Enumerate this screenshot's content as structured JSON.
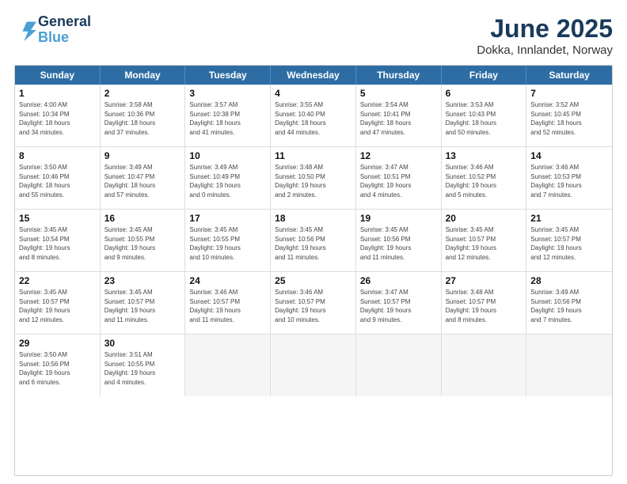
{
  "header": {
    "logo_line1": "General",
    "logo_line2": "Blue",
    "title": "June 2025",
    "subtitle": "Dokka, Innlandet, Norway"
  },
  "days_of_week": [
    "Sunday",
    "Monday",
    "Tuesday",
    "Wednesday",
    "Thursday",
    "Friday",
    "Saturday"
  ],
  "weeks": [
    [
      {
        "day": "1",
        "info": "Sunrise: 4:00 AM\nSunset: 10:34 PM\nDaylight: 18 hours\nand 34 minutes."
      },
      {
        "day": "2",
        "info": "Sunrise: 3:58 AM\nSunset: 10:36 PM\nDaylight: 18 hours\nand 37 minutes."
      },
      {
        "day": "3",
        "info": "Sunrise: 3:57 AM\nSunset: 10:38 PM\nDaylight: 18 hours\nand 41 minutes."
      },
      {
        "day": "4",
        "info": "Sunrise: 3:55 AM\nSunset: 10:40 PM\nDaylight: 18 hours\nand 44 minutes."
      },
      {
        "day": "5",
        "info": "Sunrise: 3:54 AM\nSunset: 10:41 PM\nDaylight: 18 hours\nand 47 minutes."
      },
      {
        "day": "6",
        "info": "Sunrise: 3:53 AM\nSunset: 10:43 PM\nDaylight: 18 hours\nand 50 minutes."
      },
      {
        "day": "7",
        "info": "Sunrise: 3:52 AM\nSunset: 10:45 PM\nDaylight: 18 hours\nand 52 minutes."
      }
    ],
    [
      {
        "day": "8",
        "info": "Sunrise: 3:50 AM\nSunset: 10:46 PM\nDaylight: 18 hours\nand 55 minutes."
      },
      {
        "day": "9",
        "info": "Sunrise: 3:49 AM\nSunset: 10:47 PM\nDaylight: 18 hours\nand 57 minutes."
      },
      {
        "day": "10",
        "info": "Sunrise: 3:49 AM\nSunset: 10:49 PM\nDaylight: 19 hours\nand 0 minutes."
      },
      {
        "day": "11",
        "info": "Sunrise: 3:48 AM\nSunset: 10:50 PM\nDaylight: 19 hours\nand 2 minutes."
      },
      {
        "day": "12",
        "info": "Sunrise: 3:47 AM\nSunset: 10:51 PM\nDaylight: 19 hours\nand 4 minutes."
      },
      {
        "day": "13",
        "info": "Sunrise: 3:46 AM\nSunset: 10:52 PM\nDaylight: 19 hours\nand 5 minutes."
      },
      {
        "day": "14",
        "info": "Sunrise: 3:46 AM\nSunset: 10:53 PM\nDaylight: 19 hours\nand 7 minutes."
      }
    ],
    [
      {
        "day": "15",
        "info": "Sunrise: 3:45 AM\nSunset: 10:54 PM\nDaylight: 19 hours\nand 8 minutes."
      },
      {
        "day": "16",
        "info": "Sunrise: 3:45 AM\nSunset: 10:55 PM\nDaylight: 19 hours\nand 9 minutes."
      },
      {
        "day": "17",
        "info": "Sunrise: 3:45 AM\nSunset: 10:55 PM\nDaylight: 19 hours\nand 10 minutes."
      },
      {
        "day": "18",
        "info": "Sunrise: 3:45 AM\nSunset: 10:56 PM\nDaylight: 19 hours\nand 11 minutes."
      },
      {
        "day": "19",
        "info": "Sunrise: 3:45 AM\nSunset: 10:56 PM\nDaylight: 19 hours\nand 11 minutes."
      },
      {
        "day": "20",
        "info": "Sunrise: 3:45 AM\nSunset: 10:57 PM\nDaylight: 19 hours\nand 12 minutes."
      },
      {
        "day": "21",
        "info": "Sunrise: 3:45 AM\nSunset: 10:57 PM\nDaylight: 19 hours\nand 12 minutes."
      }
    ],
    [
      {
        "day": "22",
        "info": "Sunrise: 3:45 AM\nSunset: 10:57 PM\nDaylight: 19 hours\nand 12 minutes."
      },
      {
        "day": "23",
        "info": "Sunrise: 3:45 AM\nSunset: 10:57 PM\nDaylight: 19 hours\nand 11 minutes."
      },
      {
        "day": "24",
        "info": "Sunrise: 3:46 AM\nSunset: 10:57 PM\nDaylight: 19 hours\nand 11 minutes."
      },
      {
        "day": "25",
        "info": "Sunrise: 3:46 AM\nSunset: 10:57 PM\nDaylight: 19 hours\nand 10 minutes."
      },
      {
        "day": "26",
        "info": "Sunrise: 3:47 AM\nSunset: 10:57 PM\nDaylight: 19 hours\nand 9 minutes."
      },
      {
        "day": "27",
        "info": "Sunrise: 3:48 AM\nSunset: 10:57 PM\nDaylight: 19 hours\nand 8 minutes."
      },
      {
        "day": "28",
        "info": "Sunrise: 3:49 AM\nSunset: 10:56 PM\nDaylight: 19 hours\nand 7 minutes."
      }
    ],
    [
      {
        "day": "29",
        "info": "Sunrise: 3:50 AM\nSunset: 10:56 PM\nDaylight: 19 hours\nand 6 minutes."
      },
      {
        "day": "30",
        "info": "Sunrise: 3:51 AM\nSunset: 10:55 PM\nDaylight: 19 hours\nand 4 minutes."
      },
      {
        "day": "",
        "info": ""
      },
      {
        "day": "",
        "info": ""
      },
      {
        "day": "",
        "info": ""
      },
      {
        "day": "",
        "info": ""
      },
      {
        "day": "",
        "info": ""
      }
    ]
  ]
}
